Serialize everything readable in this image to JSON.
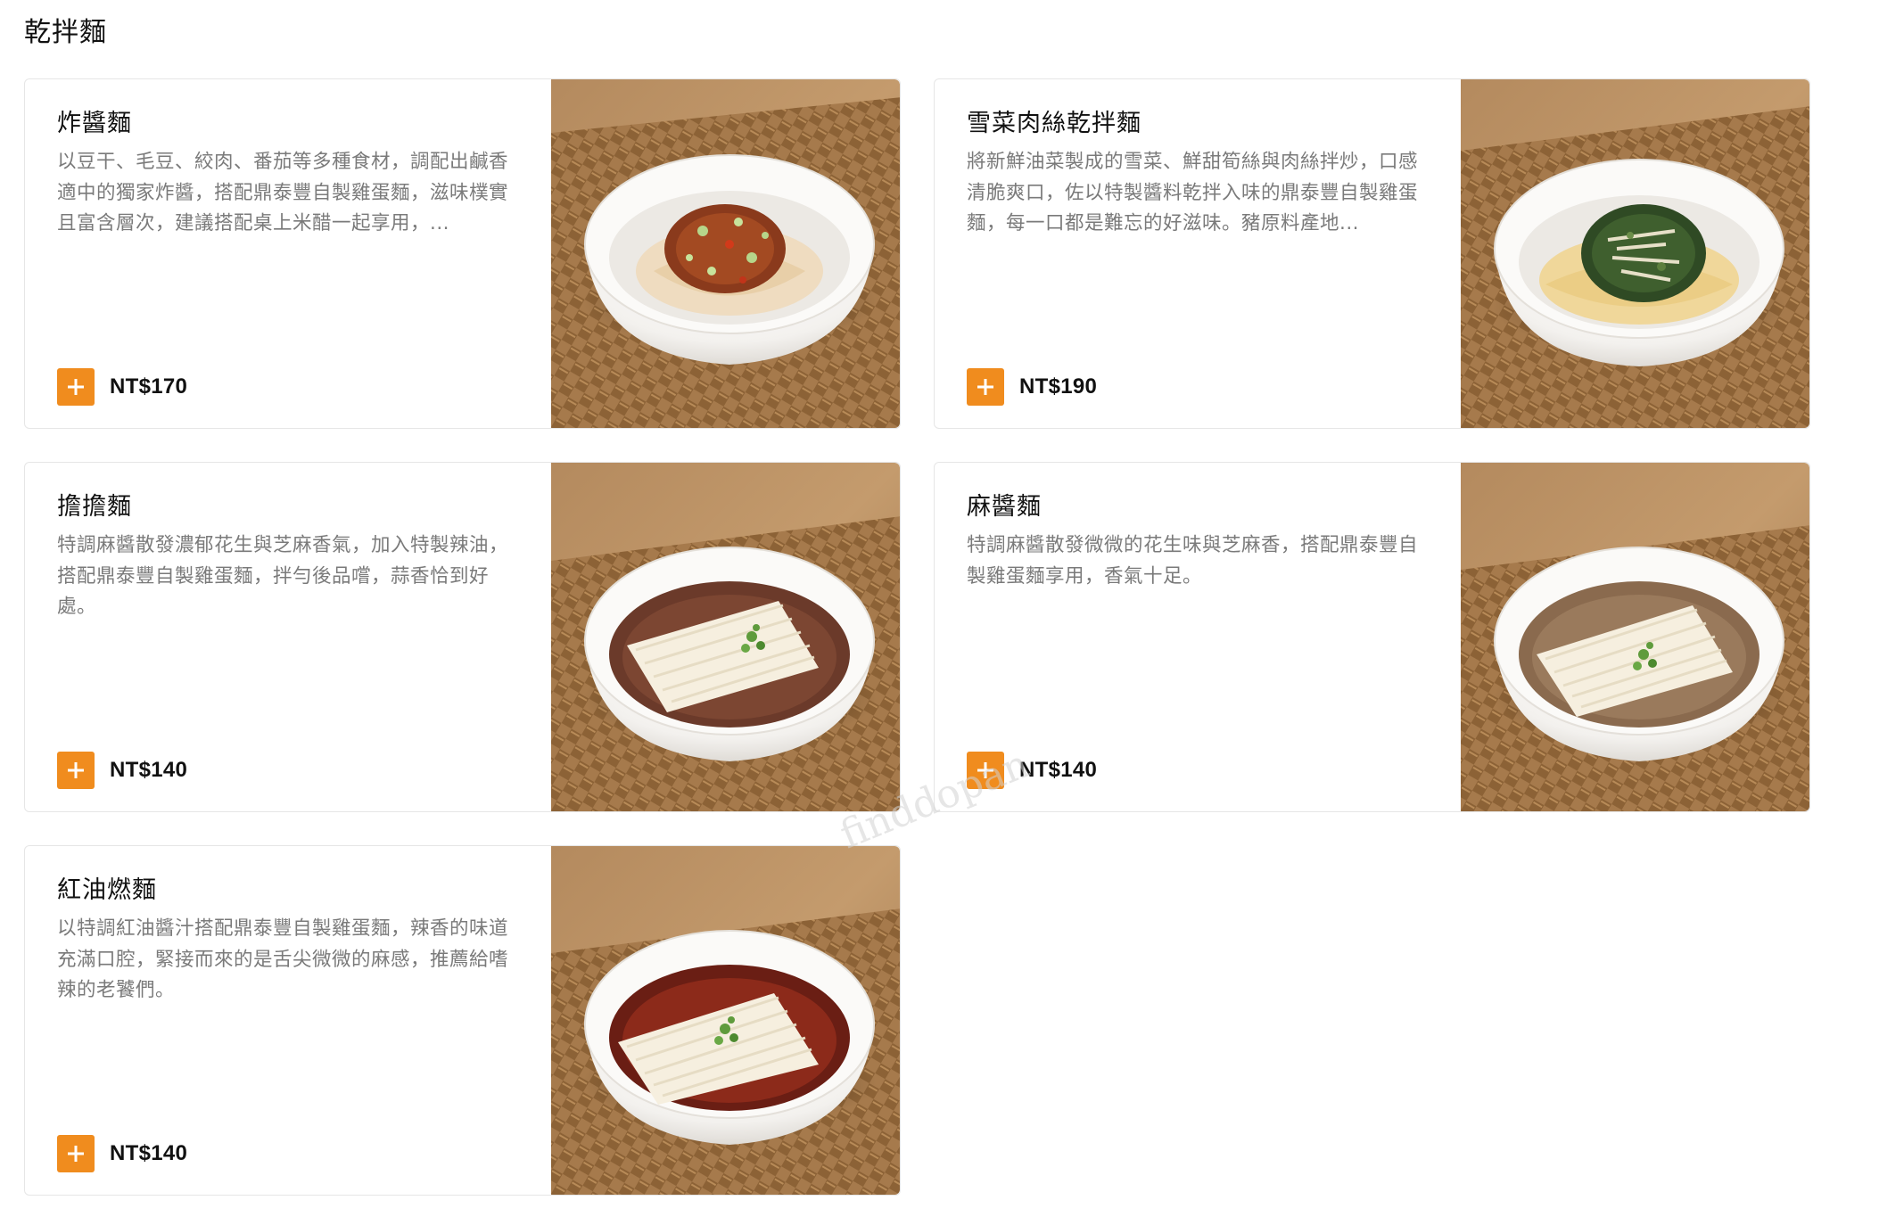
{
  "section": {
    "title": "乾拌麵"
  },
  "items": [
    {
      "name": "炸醬麵",
      "description": "以豆干、毛豆、絞肉、番茄等多種食材，調配出鹹香適中的獨家炸醬，搭配鼎泰豐自製雞蛋麵，滋味樸實且富含層次，建議搭配桌上米醋一起享用，...",
      "price": "NT$170",
      "add_icon": "plus-icon",
      "photo": "noodles-with-minced-pork-sauce"
    },
    {
      "name": "雪菜肉絲乾拌麵",
      "description": "將新鮮油菜製成的雪菜、鮮甜筍絲與肉絲拌炒，口感清脆爽口，佐以特製醬料乾拌入味的鼎泰豐自製雞蛋麵，每一口都是難忘的好滋味。豬原料產地...",
      "price": "NT$190",
      "add_icon": "plus-icon",
      "photo": "noodles-with-pickled-greens-and-pork"
    },
    {
      "name": "擔擔麵",
      "description": "特調麻醬散發濃郁花生與芝麻香氣，加入特製辣油，搭配鼎泰豐自製雞蛋麵，拌勻後品嚐，蒜香恰到好處。",
      "price": "NT$140",
      "add_icon": "plus-icon",
      "photo": "dan-dan-noodles"
    },
    {
      "name": "麻醬麵",
      "description": "特調麻醬散發微微的花生味與芝麻香，搭配鼎泰豐自製雞蛋麵享用，香氣十足。",
      "price": "NT$140",
      "add_icon": "plus-icon",
      "photo": "sesame-paste-noodles"
    },
    {
      "name": "紅油燃麵",
      "description": "以特調紅油醬汁搭配鼎泰豐自製雞蛋麵，辣香的味道充滿口腔，緊接而來的是舌尖微微的麻感，推薦給嗜辣的老饕們。",
      "price": "NT$140",
      "add_icon": "plus-icon",
      "photo": "noodles-in-chili-oil"
    }
  ],
  "watermark": "finddopan",
  "colors": {
    "accent": "#f08c1e",
    "card_border": "#e6e6e6",
    "description_text": "#7a7a7a"
  }
}
